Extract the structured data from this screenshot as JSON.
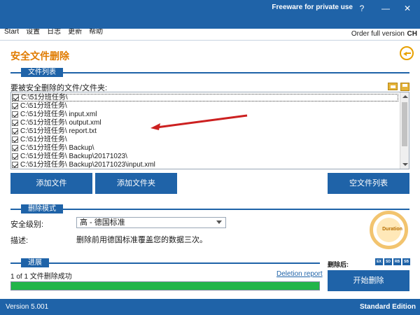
{
  "window": {
    "promo": "Freeware for private use",
    "help_label": "?",
    "minimize_label": "—",
    "close_label": "✕",
    "accent": "#1f63a8"
  },
  "menu": {
    "items": [
      "Start",
      "设置",
      "日志",
      "更新",
      "帮助"
    ],
    "order_label": "Order full version",
    "lang_label": "CH"
  },
  "page": {
    "title": "安全文件删除",
    "back_icon": "back-arrow-icon",
    "title_color": "#e07b00"
  },
  "file_section": {
    "tag": "文件列表",
    "label": "要被安全删除的文件/文件夹:",
    "icons": [
      "folder-icon",
      "save-icon"
    ],
    "rows": [
      "C:\\51分班任务\\",
      "C:\\51分班任务\\",
      "C:\\51分班任务\\                    input.xml",
      "C:\\51分班任务\\                    output.xml",
      "C:\\51分班任务\\                    report.txt",
      "C:\\51分班任务\\",
      "C:\\51分班任务\\                    Backup\\",
      "C:\\51分班任务\\                    Backup\\20171023\\",
      "C:\\51分班任务\\                    Backup\\20171023\\input.xml"
    ],
    "buttons": {
      "add_file": "添加文件",
      "add_folder": "添加文件夹",
      "clear_list": "空文件列表"
    }
  },
  "delete_section": {
    "tag": "删除模式",
    "security_label": "安全级别:",
    "security_value": "高 - 德国标准",
    "desc_label": "描述:",
    "description": "删除前用德国标准覆盖您的数据三次。",
    "duration_label": "Duration"
  },
  "progress_section": {
    "tag": "进展",
    "status": "1 of 1 文件删除成功",
    "deletion_report": "Deletion report",
    "progress_percent": 100,
    "progress_color": "#22b54a",
    "after_label": "删除后:",
    "after_badges": [
      "EX",
      "SD",
      "RB",
      "SB"
    ],
    "start_button": "开始删除"
  },
  "footer": {
    "version": "Version 5.001",
    "edition": "Standard Edition"
  }
}
